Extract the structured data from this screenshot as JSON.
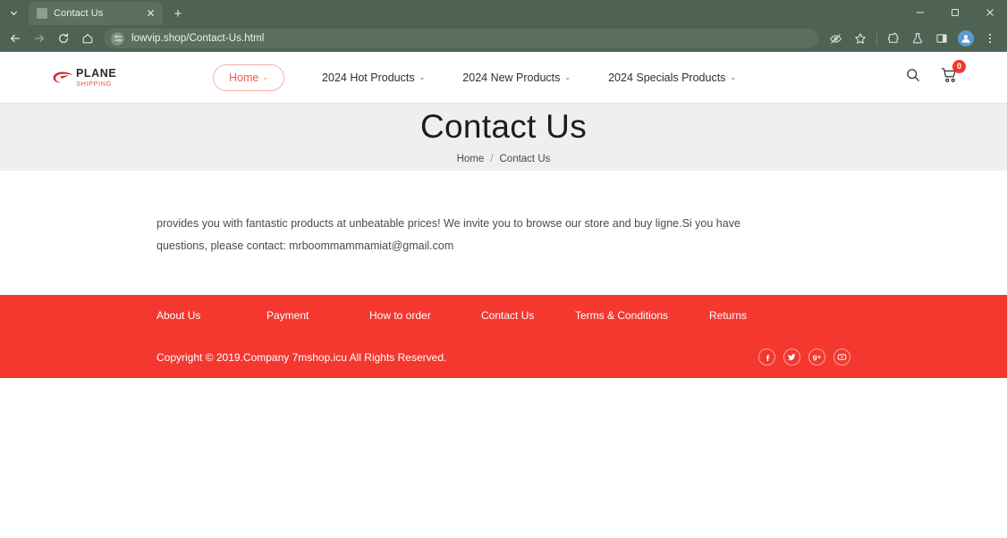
{
  "browser": {
    "tab": {
      "title": "Contact Us",
      "close_label": "✕"
    },
    "new_tab_label": "+",
    "tab_search_icon": "chevron-down-icon",
    "window": {
      "minimize": "—",
      "maximize": "◻",
      "close": "✕"
    },
    "nav": {
      "back": "←",
      "forward": "→",
      "reload": "⟳",
      "home": "⌂"
    },
    "omnibox": {
      "url": "lowvip.shop/Contact-Us.html",
      "site_settings_icon": "tune-icon",
      "tracking_protection_icon": "eye-off-icon",
      "bookmark_icon": "star-icon"
    },
    "toolbar_icons": [
      "extensions-icon",
      "labs-flask-icon",
      "side-panel-icon",
      "profile-avatar-icon",
      "more-menu-icon"
    ]
  },
  "site": {
    "logo": {
      "main": "PLANE",
      "sub": "SHIPPING",
      "mark": "plane-swoosh-icon"
    },
    "nav": [
      {
        "label": "Home",
        "caret": "⌄",
        "active": true
      },
      {
        "label": "2024 Hot Products",
        "caret": "⌄",
        "active": false
      },
      {
        "label": "2024 New Products",
        "caret": "⌄",
        "active": false
      },
      {
        "label": "2024 Specials Products",
        "caret": "⌄",
        "active": false
      }
    ],
    "header_right": {
      "search_icon": "search-icon",
      "cart_icon": "cart-icon",
      "cart_count": "0"
    },
    "hero": {
      "title": "Contact Us",
      "breadcrumb": {
        "home": "Home",
        "separator": "/",
        "current": "Contact Us"
      }
    },
    "content": {
      "paragraph": "provides you with fantastic products at unbeatable prices! We invite you to browse our store and buy ligne.Si you have questions, please contact: mrboommammamiat@gmail.com"
    },
    "footer": {
      "links": [
        "About Us",
        "Payment",
        "How to order",
        "Contact Us",
        "Terms & Conditions",
        "Returns"
      ],
      "copyright": "Copyright © 2019.Company 7mshop.icu All Rights Reserved.",
      "socials": [
        {
          "name": "facebook-icon",
          "glyph": "f"
        },
        {
          "name": "twitter-icon",
          "glyph": "t"
        },
        {
          "name": "google-plus-icon",
          "glyph": "g+"
        },
        {
          "name": "youtube-icon",
          "glyph": "▶"
        }
      ]
    }
  },
  "colors": {
    "browser_chrome": "#4e6353",
    "brand_red": "#f4372f",
    "accent_pink": "#ef5a52",
    "hero_bg": "#efefef"
  }
}
